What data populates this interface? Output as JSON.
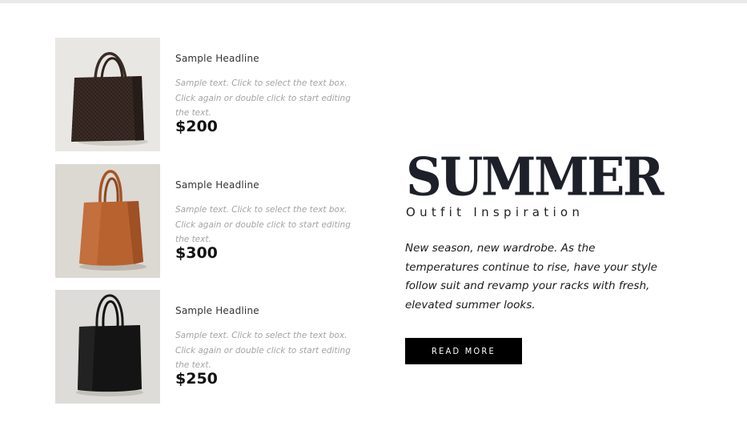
{
  "products": [
    {
      "headline": "Sample Headline",
      "description": "Sample text. Click to select the text box. Click again or double click to start editing the text.",
      "price": "$200",
      "image": "dark-woven-tote-bag"
    },
    {
      "headline": "Sample Headline",
      "description": "Sample text. Click to select the text box. Click again or double click to start editing the text.",
      "price": "$300",
      "image": "tan-leather-tote-bag"
    },
    {
      "headline": "Sample Headline",
      "description": "Sample text. Click to select the text box. Click again or double click to start editing the text.",
      "price": "$250",
      "image": "black-leather-tote-bag"
    }
  ],
  "hero": {
    "title": "SUMMER",
    "subtitle": "Outfit Inspiration",
    "body": "New season, new wardrobe. As the temperatures continue to rise, have your style follow suit and revamp your racks with fresh, elevated summer looks.",
    "button_label": "READ MORE"
  },
  "colors": {
    "title": "#1d2029",
    "button_bg": "#000000",
    "placeholder_text": "#a3a3a3",
    "bag_brown": "#b8622f",
    "bag_dark": "#2e211c",
    "bag_black": "#111111"
  }
}
